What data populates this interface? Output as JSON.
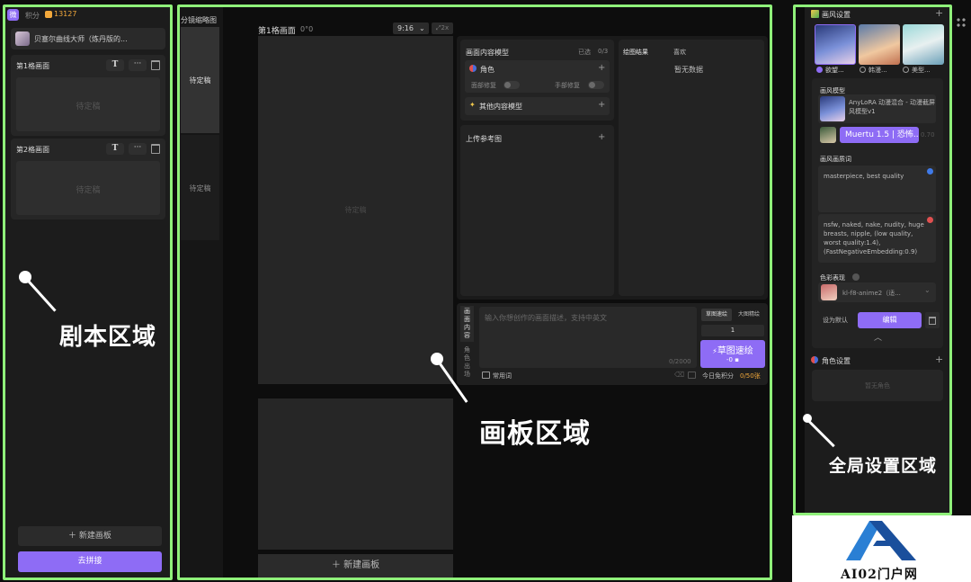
{
  "left": {
    "app_badge": "微",
    "points_label": "积分",
    "points_value": "13127",
    "script_title": "贝塞尔曲线大师（炼丹版的...",
    "panel1_title": "第1格画面",
    "panel2_title": "第2格画面",
    "pending": "待定稿",
    "new_board": "新建画板",
    "stitch": "去拼接"
  },
  "storyboard": {
    "title": "分镜缩略图",
    "item1": "待定稿",
    "item2": "待定稿"
  },
  "canvas": {
    "frame_title": "第1格画面",
    "frame_coord": "0°0",
    "ratio": "9:16",
    "zoom": "2x",
    "placeholder": "待定稿",
    "new_board": "新建画板"
  },
  "model": {
    "title": "画面内容模型",
    "selected_label": "已选",
    "selected_count": "0/3",
    "character": "角色",
    "face_fix": "面部修复",
    "hand_fix": "手部修复",
    "other_models": "其他内容模型",
    "upload_ref": "上传参考图"
  },
  "results": {
    "tab_results": "绘图结果",
    "tab_favorites": "喜欢",
    "empty": "暂无数据"
  },
  "prompt": {
    "tab_content_chars": [
      "画",
      "面",
      "内",
      "容"
    ],
    "tab_char_chars": [
      "角",
      "色",
      "出",
      "场"
    ],
    "placeholder": "输入你想创作的画面描述，支持中英文",
    "counter": "0/2000",
    "common_words": "常用词",
    "mode_sketch": "草图速绘",
    "mode_large": "大图精绘",
    "quantity": "1",
    "generate_label": "草图速绘",
    "generate_cost": "-0",
    "free_points_label": "今日免积分",
    "free_points_value": "0/50张"
  },
  "style": {
    "title": "画风设置",
    "opt1": "欲望...",
    "opt2": "韩漫...",
    "opt3": "美型...",
    "model_label": "画风模型",
    "model_name": "AnyLoRA 动漫混合 - 动漫截屏风模型v1",
    "lora_name": "Muertu 1.5 | 恐怖...",
    "lora_weight": "0.70",
    "quality_label": "画风画质词",
    "positive_prompt": "masterpiece, best quality",
    "negative_prompt": "nsfw, naked, nake, nudity, huge breasts, nipple, (low quality, worst quality:1.4), (FastNegativeEmbedding:0.9)",
    "color_label": "色彩表现",
    "color_value": "kl-f8-anime2（适...",
    "set_default": "设为默认",
    "edit": "编辑",
    "char_settings": "角色设置",
    "no_char": "暂无角色"
  },
  "annotations": {
    "script_area": "剧本区域",
    "board_area": "画板区域",
    "global_area": "全局设置区域"
  },
  "watermark": {
    "text": "AI02门户网"
  },
  "colors": {
    "frame": "#8ff07a",
    "accent": "#8e6cf5",
    "points": "#f2a83b"
  }
}
